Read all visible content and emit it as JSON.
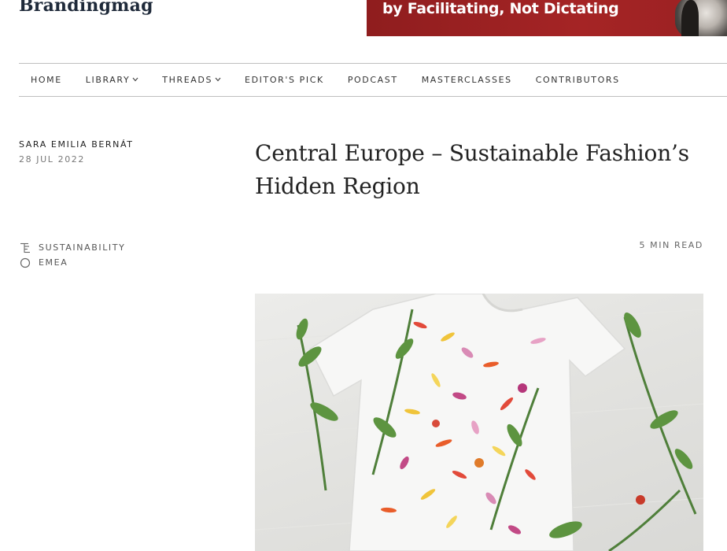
{
  "site": {
    "logo": "Brandingmag"
  },
  "banner": {
    "text": "by Facilitating, Not Dictating"
  },
  "nav": {
    "items": [
      {
        "label": "HOME",
        "has_dropdown": false
      },
      {
        "label": "LIBRARY",
        "has_dropdown": true
      },
      {
        "label": "THREADS",
        "has_dropdown": true
      },
      {
        "label": "EDITOR'S PICK",
        "has_dropdown": false
      },
      {
        "label": "PODCAST",
        "has_dropdown": false
      },
      {
        "label": "MASTERCLASSES",
        "has_dropdown": false
      },
      {
        "label": "CONTRIBUTORS",
        "has_dropdown": false
      }
    ],
    "chevron": "⌄"
  },
  "article": {
    "author": "SARA EMILIA BERNÁT",
    "date": "28 JUL 2022",
    "title": "Central Europe – Sustainable Fashion’s Hidden Region",
    "read_time": "5 MIN READ",
    "tags": [
      {
        "label": "SUSTAINABILITY",
        "icon": "topic-icon"
      },
      {
        "label": "EMEA",
        "icon": "region-circle-icon"
      }
    ]
  },
  "colors": {
    "banner_red": "#a52425",
    "nav_border": "#bfbfbf",
    "logo_navy": "#1f2a3a"
  }
}
